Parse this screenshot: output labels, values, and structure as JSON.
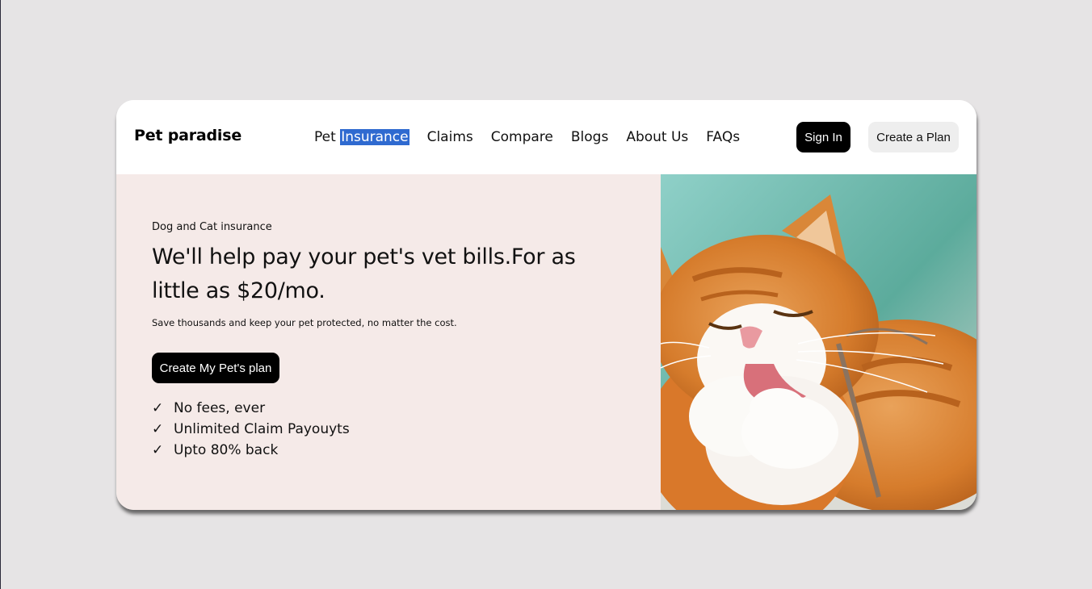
{
  "nav": {
    "logo": "Pet paradise",
    "menu": [
      {
        "pre": "Pet ",
        "selected": "Insurance"
      },
      {
        "label": "Claims"
      },
      {
        "label": "Compare"
      },
      {
        "label": "Blogs"
      },
      {
        "label": "About Us"
      },
      {
        "label": "FAQs"
      }
    ],
    "signin_label": "Sign In",
    "create_plan_label": "Create a Plan"
  },
  "hero": {
    "eyebrow": "Dog and Cat insurance",
    "headline": "We'll help pay your pet's vet bills.For as little as $20/mo.",
    "subtext": "Save thousands and keep your pet protected, no matter the cost.",
    "cta_label": "Create My Pet's plan",
    "check_glyph": "✓",
    "benefits": [
      "No fees, ever",
      "Unlimited Claim Payouyts",
      "Upto 80% back"
    ]
  },
  "image": {
    "subject": "orange-and-white-cat-licking-paw"
  },
  "colors": {
    "page_bg": "#e6e4e5",
    "hero_bg": "#f5eae8",
    "button_dark": "#000000",
    "button_light": "#eeeeee",
    "selection": "#2f6ad0"
  }
}
